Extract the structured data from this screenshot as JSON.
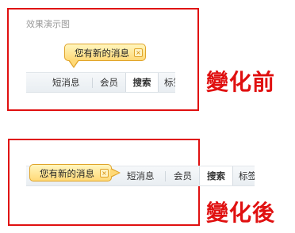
{
  "before": {
    "demo_title": "效果演示图",
    "bubble_text": "您有新的消息",
    "bubble_close_icon": "close-icon",
    "nav": [
      "短消息",
      "会员",
      "搜索",
      "标签"
    ],
    "active_tab": "搜索",
    "caption": "變化前"
  },
  "after": {
    "bubble_text": "您有新的消息",
    "bubble_close_icon": "close-icon",
    "nav": [
      "短消息",
      "会员",
      "搜索",
      "标签"
    ],
    "active_tab": "搜索",
    "caption": "變化後"
  },
  "colors": {
    "frame": "#e01010",
    "caption": "#e01010",
    "bubble_border": "#e0a42a",
    "bubble_fill": "#ffe48f",
    "navbar": "#eef2f5"
  }
}
